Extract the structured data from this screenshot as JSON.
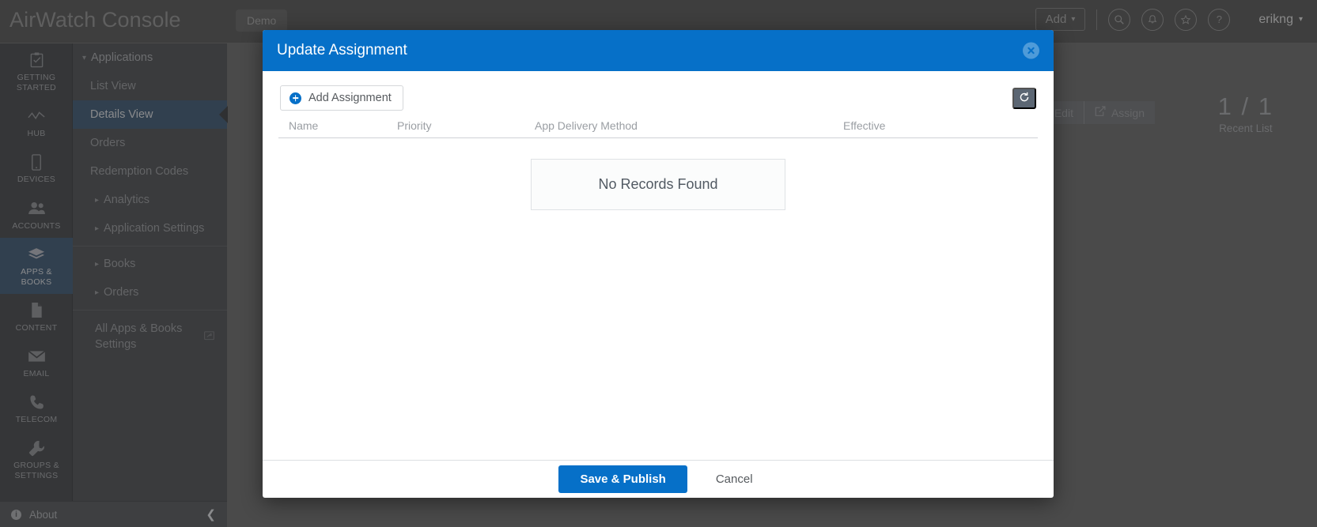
{
  "app": {
    "brand": "AirWatch Console",
    "env_tab": "Demo",
    "add_button": "Add",
    "add_caret": "⌄",
    "user": "erikng",
    "user_caret": "⌄",
    "icons": {
      "search": "search-icon",
      "notification": "bell-icon",
      "favorites": "star-icon",
      "help": "?"
    }
  },
  "rail": {
    "items": [
      {
        "label": "GETTING\nSTARTED",
        "icon": "clipboard-check-icon",
        "active": false
      },
      {
        "label": "HUB",
        "icon": "trend-line-icon",
        "active": false
      },
      {
        "label": "DEVICES",
        "icon": "mobile-device-icon",
        "active": false
      },
      {
        "label": "ACCOUNTS",
        "icon": "users-icon",
        "active": false
      },
      {
        "label": "APPS &\nBOOKS",
        "icon": "layers-icon",
        "active": true
      },
      {
        "label": "CONTENT",
        "icon": "document-icon",
        "active": false
      },
      {
        "label": "EMAIL",
        "icon": "envelope-icon",
        "active": false
      },
      {
        "label": "TELECOM",
        "icon": "phone-icon",
        "active": false
      },
      {
        "label": "GROUPS &\nSETTINGS",
        "icon": "wrench-icon",
        "active": false
      }
    ]
  },
  "nav": {
    "group_applications": "Applications",
    "items": [
      {
        "label": "List View",
        "active": false
      },
      {
        "label": "Details View",
        "active": true
      },
      {
        "label": "Orders",
        "active": false
      },
      {
        "label": "Redemption Codes",
        "active": false
      },
      {
        "label": "Analytics",
        "active": false,
        "expandable": true
      },
      {
        "label": "Application Settings",
        "active": false,
        "expandable": true
      }
    ],
    "groups": [
      {
        "label": "Books",
        "expandable": true
      },
      {
        "label": "Orders",
        "expandable": true
      }
    ],
    "all_settings": "All Apps & Books Settings",
    "about": "About",
    "about_icon": "info-icon",
    "collapse_icon": "chevron-left-icon"
  },
  "background": {
    "actions": [
      {
        "label": "Edit",
        "icon": "pencil-icon"
      },
      {
        "label": "Assign",
        "icon": "assign-icon"
      }
    ],
    "count": "1 / 1",
    "count_label": "Recent List"
  },
  "modal": {
    "title": "Update Assignment",
    "close_icon": "close-circle-icon",
    "toolbar": {
      "add_assignment": "Add Assignment",
      "add_icon": "plus-circle-icon",
      "refresh_icon": "refresh-icon"
    },
    "grid": {
      "columns": [
        "Name",
        "Priority",
        "App Delivery Method",
        "Effective"
      ],
      "rows": [],
      "empty_message": "No Records Found"
    },
    "footer": {
      "save": "Save & Publish",
      "cancel": "Cancel"
    }
  },
  "colors": {
    "accent": "#0670c8",
    "modal_header": "#0670c8",
    "rail_active": "#31404f",
    "refresh_button": "#5b6673",
    "backdrop": "#4a4a4a"
  }
}
